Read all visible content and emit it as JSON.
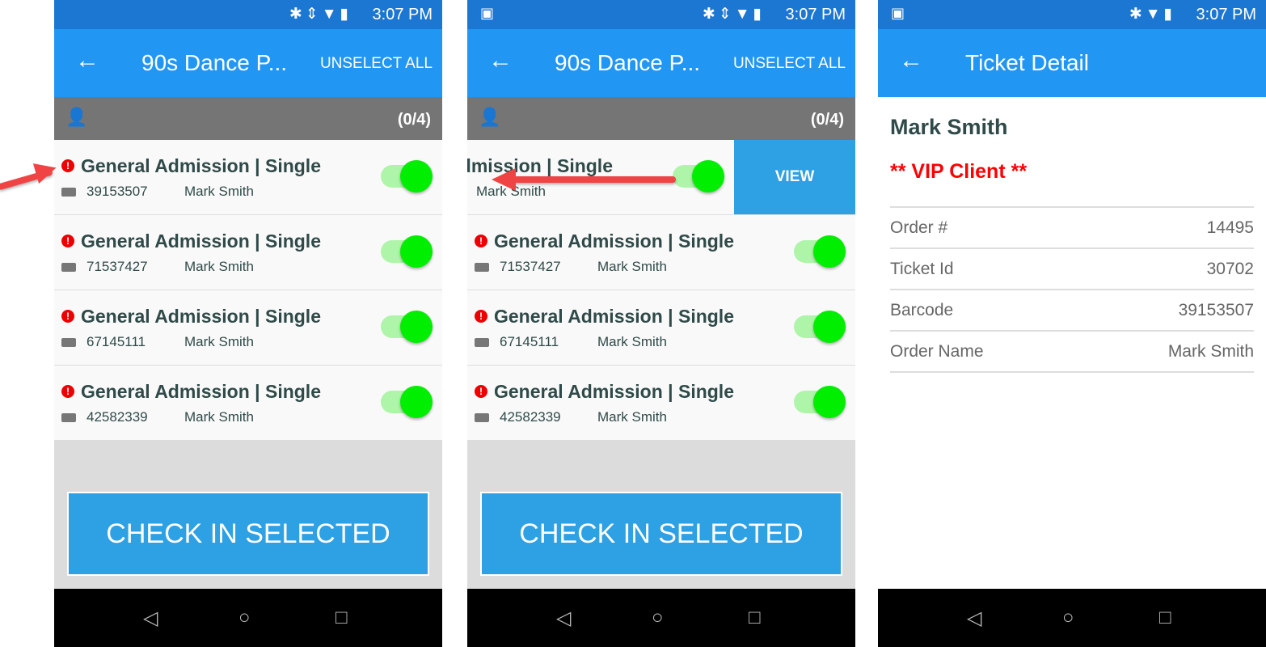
{
  "status": {
    "time": "3:07 PM"
  },
  "list": {
    "title": "90s Dance P...",
    "unselect_all": "UNSELECT ALL",
    "count": "(0/4)",
    "check_in": "CHECK IN SELECTED",
    "view": "VIEW",
    "rows": [
      {
        "title": "General Admission | Single",
        "barcode": "39153507",
        "name": "Mark Smith",
        "selected": true
      },
      {
        "title": "General Admission | Single",
        "barcode": "71537427",
        "name": "Mark Smith",
        "selected": true
      },
      {
        "title": "General Admission | Single",
        "barcode": "67145111",
        "name": "Mark Smith",
        "selected": true
      },
      {
        "title": "General Admission | Single",
        "barcode": "42582339",
        "name": "Mark Smith",
        "selected": true
      }
    ]
  },
  "detail": {
    "title": "Ticket Detail",
    "name": "Mark Smith",
    "note": "** VIP Client **",
    "fields": [
      {
        "label": "Order #",
        "value": "14495"
      },
      {
        "label": "Ticket Id",
        "value": "30702"
      },
      {
        "label": "Barcode",
        "value": "39153507"
      },
      {
        "label": "Order Name",
        "value": "Mark Smith"
      }
    ]
  },
  "colors": {
    "status_bar": "#1b77d2",
    "app_bar": "#2196f3",
    "accent": "#2ea0e4",
    "toggle_on": "#00ee00",
    "warning": "#ee0000",
    "vip": "#ff0000"
  }
}
